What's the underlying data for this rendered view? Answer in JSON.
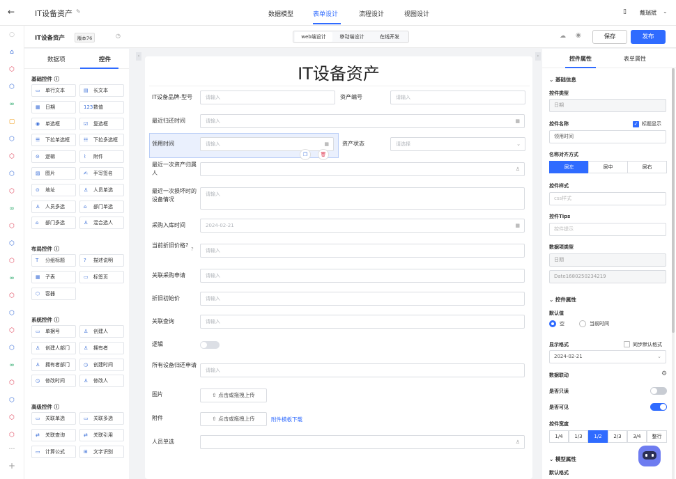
{
  "topbar": {
    "app_title": "IT设备资产",
    "tabs": [
      "数据模型",
      "表单设计",
      "流程设计",
      "视图设计"
    ],
    "user": "戴瑞斌"
  },
  "subbar": {
    "title": "IT设备资产",
    "version": "版本76",
    "modes": [
      "web端设计",
      "移动端设计",
      "在线开发"
    ],
    "save": "保存",
    "publish": "发布"
  },
  "left": {
    "tabs": [
      "数据项",
      "控件"
    ],
    "groups": [
      {
        "title": "基础控件",
        "items": [
          "单行文本",
          "长文本",
          "日期",
          "数值",
          "单选框",
          "复选框",
          "下拉单选框",
          "下拉多选框",
          "逻辑",
          "附件",
          "图片",
          "手写签名",
          "地址",
          "人员单选",
          "人员多选",
          "部门单选",
          "部门多选",
          "混合选人"
        ]
      },
      {
        "title": "布局控件",
        "items": [
          "分组标题",
          "描述说明",
          "子表",
          "标签页",
          "容器"
        ]
      },
      {
        "title": "系统控件",
        "items": [
          "单据号",
          "创建人",
          "创建人部门",
          "拥有者",
          "拥有者部门",
          "创建时间",
          "修改时间",
          "修改人"
        ]
      },
      {
        "title": "高级控件",
        "items": [
          "关联单选",
          "关联多选",
          "关联查询",
          "关联引用",
          "计算公式",
          "文字识别"
        ]
      }
    ]
  },
  "form": {
    "title": "IT设备资产",
    "fields": {
      "brand_label": "IT设备品牌-型号",
      "brand_ph": "请输入",
      "asset_no_label": "资产编号",
      "asset_no_ph": "请输入",
      "return_label": "最近归还时间",
      "return_ph": "请输入",
      "receive_label": "领用时间",
      "receive_ph": "请输入",
      "status_label": "资产状态",
      "status_ph": "请选择",
      "owner_label": "最近一次资产归属人",
      "damage_label": "最近一次损坏时的设备情况",
      "damage_ph": "请输入",
      "purchase_label": "采购入库时间",
      "purchase_val": "2024-02-21",
      "depr_label": "当前折旧价格?",
      "depr_ph": "请输入",
      "req_label": "关联采购申请",
      "req_ph": "请输入",
      "orig_label": "折旧初始价",
      "orig_ph": "请输入",
      "query_label": "关联查询",
      "query_ph": "请输入",
      "logic_label": "逻辑",
      "allreturn_label": "所有设备归还申请",
      "allreturn_ph": "请输入",
      "image_label": "图片",
      "upload": "点击或拖拽上传",
      "attach_label": "附件",
      "template": "附件模板下载",
      "person_label": "人员单选"
    }
  },
  "right": {
    "tabs": [
      "控件属性",
      "表单属性"
    ],
    "basic": "基础信息",
    "type_label": "控件类型",
    "type_val": "日期",
    "name_label": "控件名称",
    "title_show": "标题显示",
    "name_val": "领用时间",
    "align_label": "名称对齐方式",
    "align": [
      "居左",
      "居中",
      "居右"
    ],
    "style_label": "控件样式",
    "style_ph": "css样式",
    "tips_label": "控件Tips",
    "tips_ph": "控件提示",
    "dtype_label": "数据项类型",
    "dtype_val": "日期",
    "dtype_id": "Date1680250234219",
    "props": "控件属性",
    "default_label": "默认值",
    "def_opts": [
      "空",
      "当前时间"
    ],
    "fmt_label": "显示格式",
    "sync_label": "同步默认格式",
    "fmt_val": "2024-02-21",
    "link_label": "数据联动",
    "readonly_label": "是否只读",
    "visible_label": "是否可见",
    "width_label": "控件宽度",
    "widths": [
      "1/4",
      "1/3",
      "1/2",
      "2/3",
      "3/4",
      "整行"
    ],
    "model": "模型属性",
    "default_fmt": "默认格式"
  },
  "colors": {
    "accent": "#2f6bff"
  }
}
